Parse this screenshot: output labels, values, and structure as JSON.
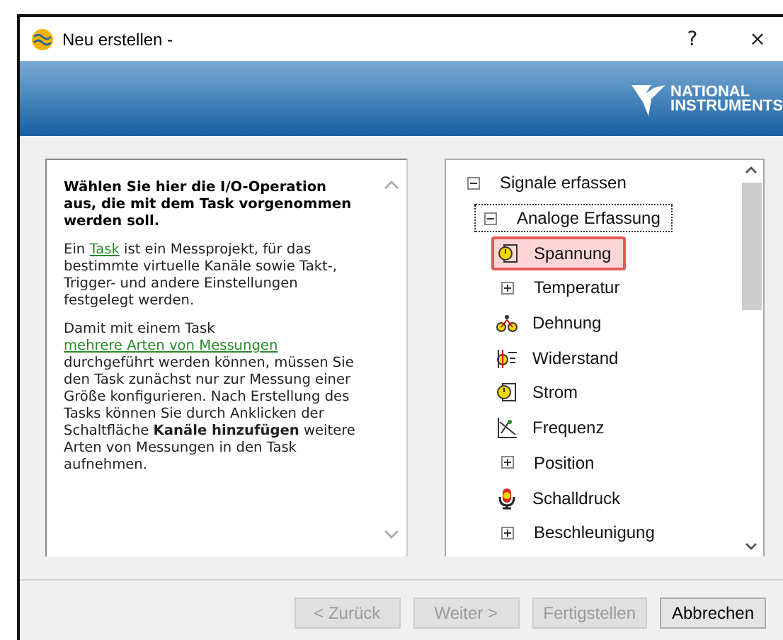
{
  "window": {
    "title": "Neu erstellen -",
    "help": "?",
    "close": "×"
  },
  "banner": {
    "logo_line_1": "NATIONAL",
    "logo_line_2": "INSTRUMENTS"
  },
  "help_text": [
    {
      "kind": "heading",
      "parts": [
        {
          "text": "Wählen Sie hier die I/O-Operation aus, die mit dem Task vorgenommen werden soll.",
          "link": false
        }
      ]
    },
    {
      "kind": "body",
      "parts": [
        {
          "text": "Ein ",
          "link": false
        },
        {
          "text": "Task",
          "link": true
        },
        {
          "text": " ist ein Messprojekt, für das bestimmte virtuelle Kanäle sowie Takt-, Trigger- und andere Einstellungen festgelegt werden.",
          "link": false
        }
      ]
    },
    {
      "kind": "body",
      "parts": [
        {
          "text": "Damit mit einem Task ",
          "link": false
        },
        {
          "text": "mehrere Arten von Messungen",
          "link": true
        },
        {
          "text": " durchgeführt werden können, müssen Sie den Task zunächst nur zur Messung einer Größe konfigurieren. Nach Erstellung des Tasks können Sie durch Anklicken der Schaltfläche **Kanäle hinzufügen** weitere Arten von Messungen in den Task aufnehmen.",
          "link": false
        }
      ]
    }
  ],
  "tree": [
    {
      "label": "Signale erfassen",
      "kind": "branch",
      "expanded": true,
      "selected": false,
      "focused": false,
      "children": [
        {
          "label": "Analoge Erfassung",
          "kind": "branch",
          "expanded": true,
          "selected": false,
          "focused": true,
          "children": [
            {
              "label": "Spannung",
              "kind": "leaf",
              "selected": true,
              "focused": false
            },
            {
              "label": "Temperatur",
              "kind": "branch",
              "expanded": false,
              "selected": false,
              "focused": false
            },
            {
              "label": "Dehnung",
              "kind": "leaf",
              "selected": false,
              "focused": false
            },
            {
              "label": "Widerstand",
              "kind": "leaf",
              "selected": false,
              "focused": false
            },
            {
              "label": "Strom",
              "kind": "leaf",
              "selected": false,
              "focused": false
            },
            {
              "label": "Frequenz",
              "kind": "leaf",
              "selected": false,
              "focused": false
            },
            {
              "label": "Position",
              "kind": "branch",
              "expanded": false,
              "selected": false,
              "focused": false
            },
            {
              "label": "Schalldruck",
              "kind": "leaf",
              "selected": false,
              "focused": false
            },
            {
              "label": "Beschleunigung",
              "kind": "branch",
              "expanded": false,
              "selected": false,
              "focused": false
            }
          ]
        }
      ]
    }
  ],
  "buttons": [
    {
      "label": "< Zurück",
      "disabled": true
    },
    {
      "label": "Weiter >",
      "disabled": true
    },
    {
      "label": "Fertigstellen",
      "disabled": true
    },
    {
      "label": "Abbrechen",
      "disabled": false
    }
  ]
}
